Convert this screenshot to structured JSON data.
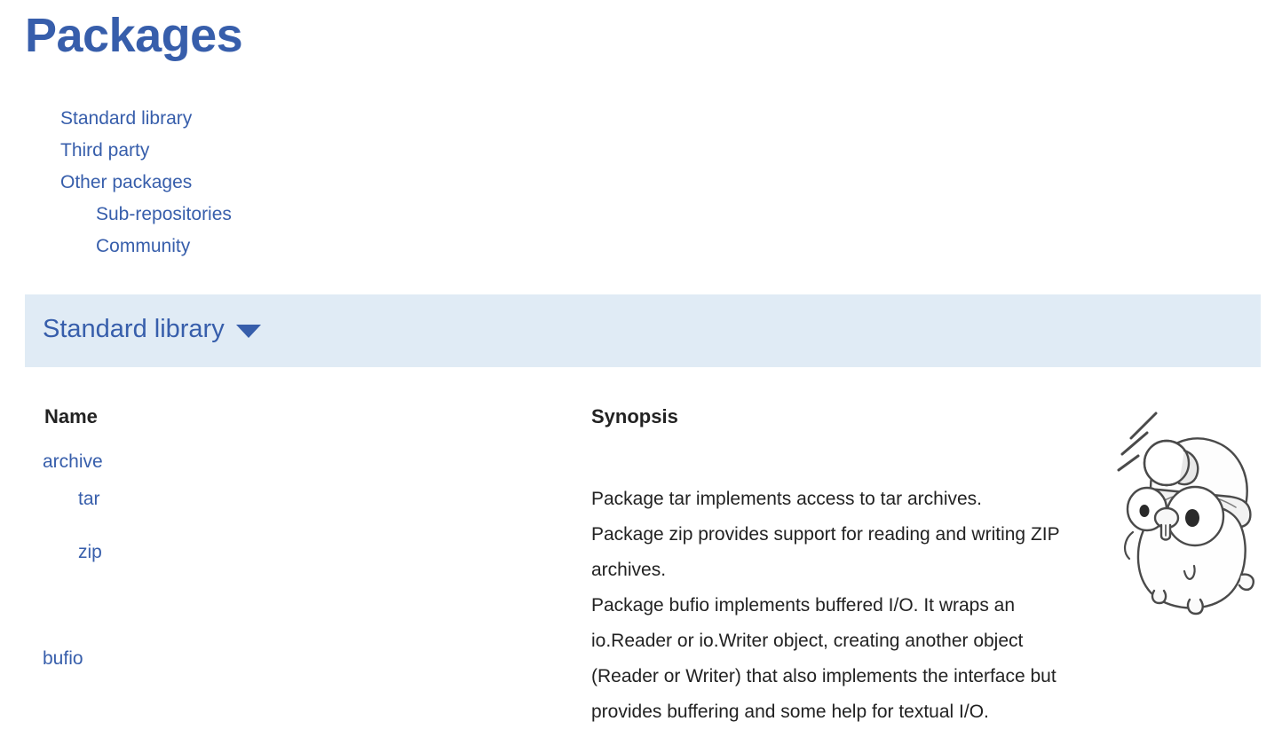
{
  "page": {
    "title": "Packages",
    "title_color": "#375EAB",
    "banner_bg": "#E0EBF5",
    "text_color": "#222222"
  },
  "nav": {
    "items": [
      {
        "label": "Standard library",
        "nested": false
      },
      {
        "label": "Third party",
        "nested": false
      },
      {
        "label": "Other packages",
        "nested": false
      },
      {
        "label": "Sub-repositories",
        "nested": true
      },
      {
        "label": "Community",
        "nested": true
      }
    ]
  },
  "section": {
    "title": "Standard library",
    "caret_icon": "chevron-down-icon"
  },
  "table": {
    "headers": {
      "name": "Name",
      "synopsis": "Synopsis"
    },
    "rows": [
      {
        "name": "archive",
        "indent": false,
        "synopsis": ""
      },
      {
        "name": "tar",
        "indent": true,
        "synopsis": "Package tar implements access to tar archives."
      },
      {
        "name": "zip",
        "indent": true,
        "synopsis": "Package zip provides support for reading and writing ZIP archives."
      },
      {
        "name": "bufio",
        "indent": false,
        "synopsis": "Package bufio implements buffered I/O. It wraps an io.Reader or io.Writer object, creating another object (Reader or Writer) that also implements the interface but provides buffering and some help for textual I/O."
      }
    ]
  },
  "mascot": {
    "name": "go-gopher-mascot",
    "description": "Go gopher wearing a miner's helmet with headlamp"
  }
}
